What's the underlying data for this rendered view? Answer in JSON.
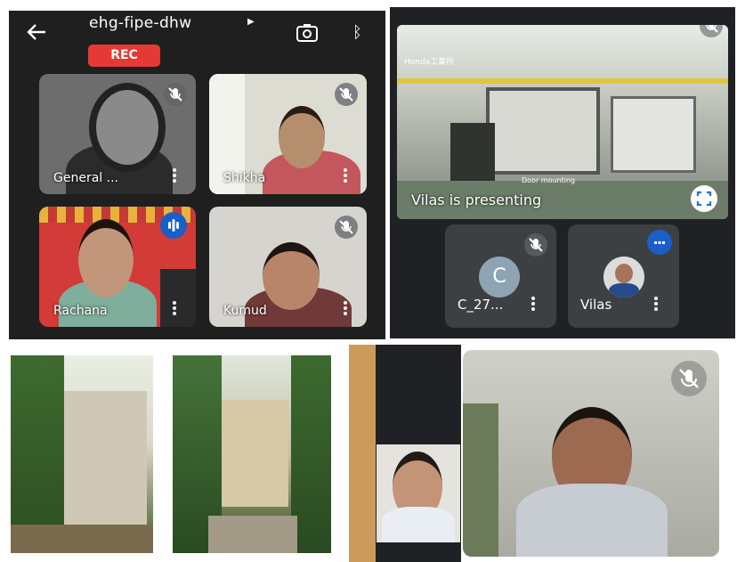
{
  "meeting": {
    "title": "ehg-fipe-dhw",
    "rec_label": "REC"
  },
  "grid_tiles": [
    {
      "name": "General ...",
      "mic": "mic-off"
    },
    {
      "name": "Shikha",
      "mic": "mic-off"
    },
    {
      "name": "Rachana",
      "mic": "speaking"
    },
    {
      "name": "Kumud",
      "mic": "mic-off"
    }
  ],
  "presentation": {
    "label": "Vilas is presenting",
    "slide_brand": "Honda工業所",
    "slide_caption": "Door mounting"
  },
  "small_tiles": [
    {
      "name": "C_27...",
      "avatar_letter": "C",
      "mic": "mic-off"
    },
    {
      "name": "Vilas",
      "mic": "speaking"
    }
  ],
  "colors": {
    "rec_red": "#e53935",
    "speaking_blue": "#1a5fc6",
    "tile_dark": "#3c4043"
  },
  "icons": [
    "back-arrow-icon",
    "chevron-right-icon",
    "switch-camera-icon",
    "bluetooth-icon",
    "mic-off-icon",
    "speaking-icon",
    "more-vert-icon",
    "fullscreen-icon"
  ]
}
